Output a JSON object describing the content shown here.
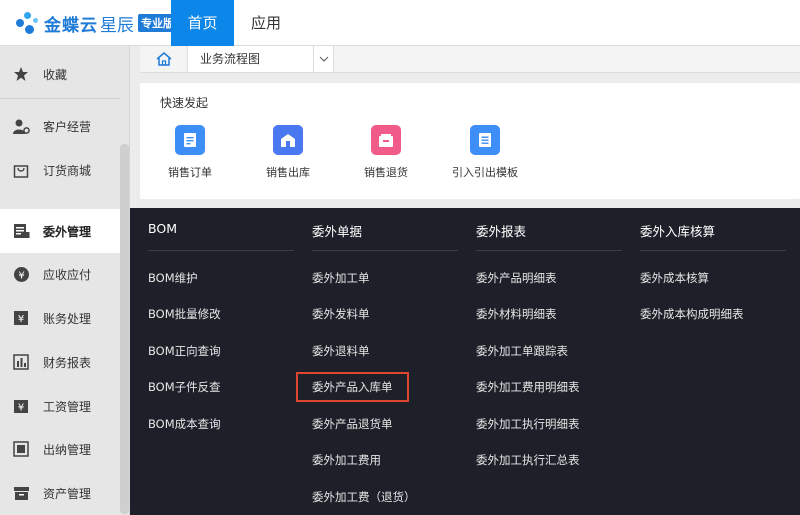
{
  "header": {
    "logo_brand": "金蝶云",
    "logo_product": "星辰",
    "logo_edition": "专业版",
    "tabs": [
      {
        "label": "首页",
        "active": true
      },
      {
        "label": "应用",
        "active": false
      }
    ]
  },
  "sidebar": {
    "items": [
      {
        "label": "收藏",
        "icon": "star-icon"
      },
      {
        "label": "客户经营",
        "icon": "user-gear-icon"
      },
      {
        "label": "订货商城",
        "icon": "shopping-bag-icon"
      },
      {
        "label": "委外管理",
        "icon": "outsource-doc-icon",
        "active": true
      },
      {
        "label": "应收应付",
        "icon": "yen-coin-icon"
      },
      {
        "label": "账务处理",
        "icon": "yen-ledger-icon"
      },
      {
        "label": "财务报表",
        "icon": "bar-chart-icon"
      },
      {
        "label": "工资管理",
        "icon": "salary-icon"
      },
      {
        "label": "出纳管理",
        "icon": "cashier-icon"
      },
      {
        "label": "资产管理",
        "icon": "asset-box-icon"
      }
    ]
  },
  "breadcrumb": {
    "tab_label": "业务流程图"
  },
  "quick_start": {
    "title": "快速发起",
    "items": [
      {
        "label": "销售订单",
        "color": "#3e8ef7"
      },
      {
        "label": "销售出库",
        "color": "#4a78f0"
      },
      {
        "label": "销售退货",
        "color": "#f05b8a"
      },
      {
        "label": "引入引出模板",
        "color": "#3e8ef7"
      }
    ]
  },
  "flyout": {
    "columns": [
      {
        "heading": "BOM",
        "items": [
          "BOM维护",
          "BOM批量修改",
          "BOM正向查询",
          "BOM子件反查",
          "BOM成本查询"
        ]
      },
      {
        "heading": "委外单据",
        "items": [
          "委外加工单",
          "委外发料单",
          "委外退料单",
          "委外产品入库单",
          "委外产品退货单",
          "委外加工费用",
          "委外加工费（退货）"
        ],
        "highlighted_item": "委外产品入库单"
      },
      {
        "heading": "委外报表",
        "items": [
          "委外产品明细表",
          "委外材料明细表",
          "委外加工单跟踪表",
          "委外加工费用明细表",
          "委外加工执行明细表",
          "委外加工执行汇总表"
        ]
      },
      {
        "heading": "委外入库核算",
        "items": [
          "委外成本核算",
          "委外成本构成明细表"
        ]
      }
    ]
  },
  "colors": {
    "accent": "#0c86e8",
    "flyout_bg": "#1e2029",
    "highlight_border": "#e0452f"
  }
}
